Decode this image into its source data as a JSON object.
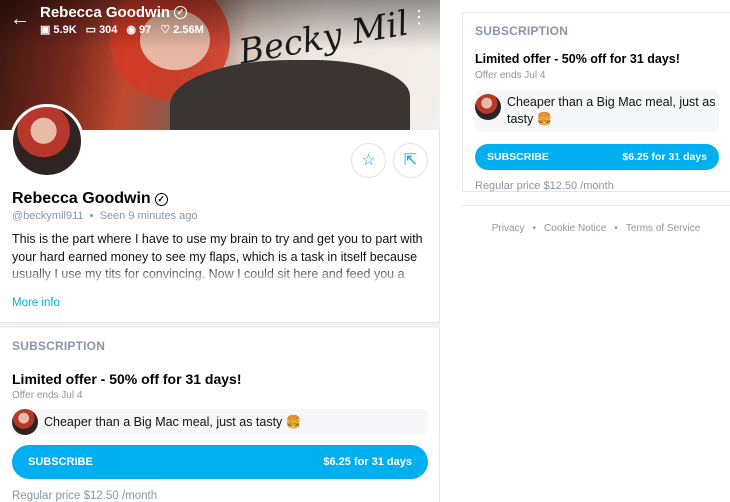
{
  "profile": {
    "name": "Rebecca Goodwin",
    "handle": "@beckymil911",
    "seen": "Seen  9 minutes ago",
    "bio": "This is the part where I have to use my brain to try and get you to part with your hard earned money to see my flaps, which is a task in itself because usually I use my tits for convincing. Now I could sit here and feed you a load of BS about",
    "more_label": "More info",
    "cover_signature": "Becky Mil",
    "stats": {
      "photos": "5.9K",
      "videos": "304",
      "streams": "97",
      "likes": "2.56M"
    }
  },
  "subscription": {
    "section_label": "SUBSCRIPTION",
    "offer_title": "Limited offer - 50% off for 31 days!",
    "offer_ends": "Offer ends Jul 4",
    "message": "Cheaper than a Big Mac meal, just as tasty 🍔",
    "button_label": "SUBSCRIBE",
    "button_price": "$6.25 for 31 days",
    "regular_price": "Regular price $12.50 /month"
  },
  "footer": {
    "privacy": "Privacy",
    "cookie": "Cookie Notice",
    "terms": "Terms of Service",
    "dot": "•"
  },
  "icons": {
    "back": "arrow-left-icon",
    "star": "star-icon",
    "share": "share-icon",
    "more": "more-vertical-icon"
  },
  "colors": {
    "accent": "#00aff0",
    "muted": "#8a96a3"
  }
}
